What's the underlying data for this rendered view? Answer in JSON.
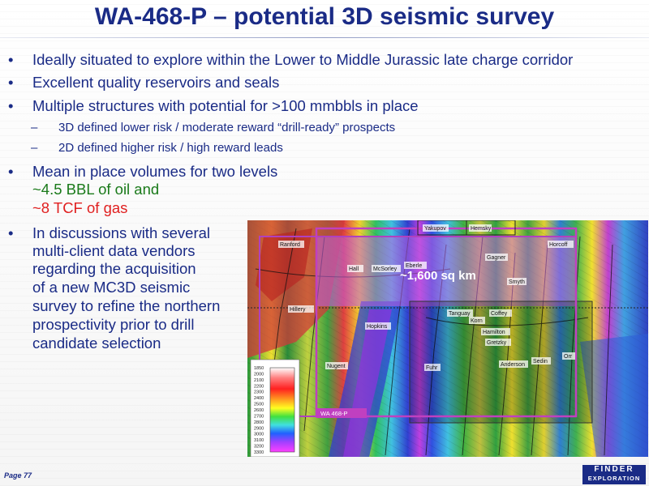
{
  "slide": {
    "title": "WA-468-P – potential 3D seismic survey",
    "bullets": [
      {
        "text": "Ideally situated to explore within the Lower to Middle Jurassic late charge corridor"
      },
      {
        "text": "Excellent quality reservoirs and seals"
      },
      {
        "text": "Multiple structures with potential for >100 mmbbls in place"
      },
      {
        "text": "Mean in place volumes for two levels"
      },
      {
        "text": "In discussions with several"
      }
    ],
    "sub_bullets": [
      "3D defined lower risk / moderate reward “drill-ready” prospects",
      "2D defined higher risk / high reward leads"
    ],
    "volumes": {
      "oil": "~4.5 BBL of oil and",
      "gas": "~8 TCF of gas"
    },
    "discussion_lines": [
      "multi-client data vendors",
      "regarding the acquisition",
      "of a new MC3D seismic",
      "survey to refine the northern",
      "prospectivity prior to drill",
      "candidate selection"
    ],
    "bullet_symbol": "•",
    "dash_symbol": "–"
  },
  "map": {
    "area_label": "~1,600 sq km",
    "permit_label": "WA 468-P",
    "prospects": [
      "Yakupov",
      "Hemsky",
      "Ranford",
      "Gagner",
      "Horcoff",
      "Hall",
      "McSorley",
      "Eberle",
      "Smyth",
      "Hillery",
      "Tanguay",
      "Coffey",
      "Korn",
      "Hopkins",
      "Hamilton",
      "Gretzky",
      "Anderson",
      "Sedin",
      "Orr",
      "Nugent",
      "Fuhr"
    ],
    "colorbar_ticks": [
      "1850",
      "2000",
      "2100",
      "2200",
      "2300",
      "2400",
      "2500",
      "2600",
      "2700",
      "2800",
      "2900",
      "3000",
      "3100",
      "3200",
      "3300"
    ],
    "colors": {
      "survey_box": "#b040c0",
      "permit_box": "#c040c0",
      "area_label_text": "#ffffff"
    }
  },
  "footer": {
    "page": "Page 77",
    "logo_line1": "FINDER",
    "logo_line2": "EXPLORATION"
  },
  "theme": {
    "title_color": "#1a2b86",
    "oil_color": "#1a7a1a",
    "gas_color": "#e02020"
  }
}
